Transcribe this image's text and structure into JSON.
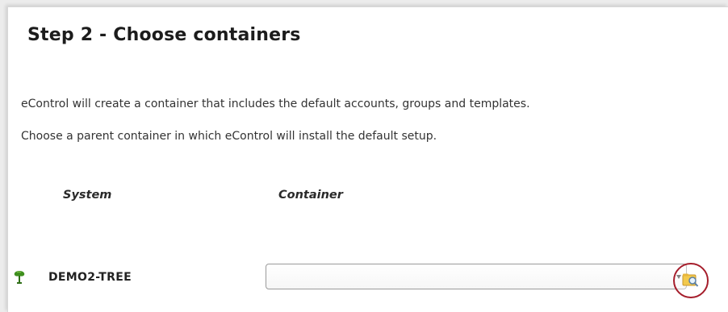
{
  "page": {
    "title": "Step 2 - Choose containers",
    "description_line1": "eControl will create a container that includes the default accounts, groups and templates.",
    "description_line2": "Choose a parent container in which eControl will install the default setup."
  },
  "table": {
    "columns": [
      "System",
      "Container"
    ],
    "rows": [
      {
        "system": "DEMO2-TREE",
        "system_icon": "tree-icon",
        "container_value": "",
        "browse_icon": "folder-browse-icon"
      }
    ]
  },
  "colors": {
    "highlight_circle": "#a51d2b",
    "tree_icon": "#3f8f1e",
    "browse_folder": "#f2c94c"
  }
}
